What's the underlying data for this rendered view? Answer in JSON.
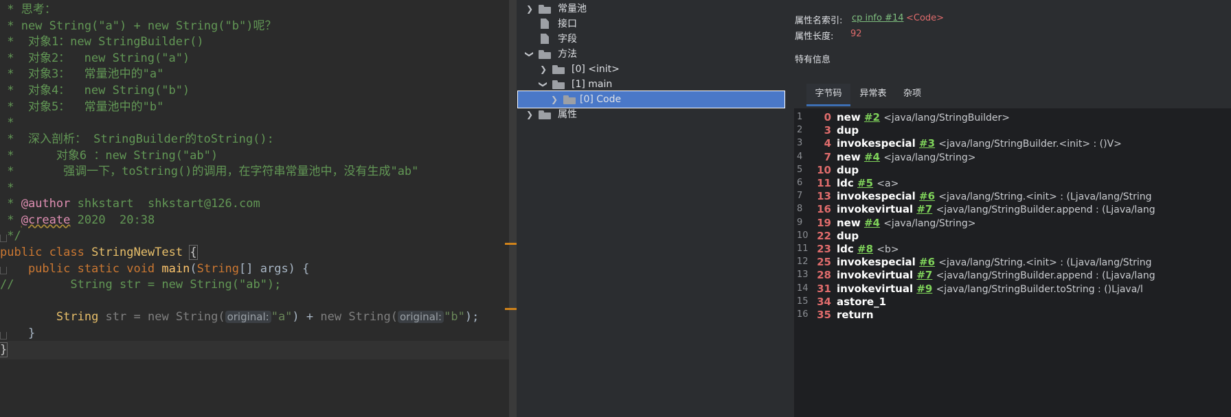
{
  "editor": {
    "lines": [
      " * 思考：",
      " * new String(\"a\") + new String(\"b\")呢？",
      " *  对象1：new StringBuilder()",
      " *  对象2：  new String(\"a\")",
      " *  对象3：  常量池中的\"a\"",
      " *  对象4：  new String(\"b\")",
      " *  对象5：  常量池中的\"b\"",
      " *",
      " *  深入剖析： StringBuilder的toString():",
      " *      对象6 ：new String(\"ab\")",
      " *       强调一下，toString()的调用，在字符串常量池中，没有生成\"ab\"",
      " *"
    ],
    "author_prefix": " * ",
    "author_tag": "@author",
    "author_text": " shkstart  shkstart@126.com",
    "create_prefix": " * ",
    "create_tag": "@create",
    "create_text": " 2020  20:38",
    "comment_end": " */",
    "class_kw": "public class ",
    "class_name": "StringNewTest",
    "class_brace": "{",
    "main_kw": "    public static void ",
    "main_name": "main",
    "main_params_open": "(",
    "main_param_type": "String",
    "main_params_rest": "[] args) {",
    "commented_line": "//        String str = new String(\"ab\");",
    "stmt_indent": "        ",
    "stmt_type": "String",
    "stmt_var": " str = ",
    "stmt_new1": "new ",
    "stmt_cls1": "String(",
    "hint1": "original:",
    "stmt_arg1": "\"a\"",
    "stmt_mid": ") + ",
    "stmt_new2": "new ",
    "stmt_cls2": "String(",
    "hint2": "original:",
    "stmt_arg2": "\"b\"",
    "stmt_end": ");",
    "close_method": "    }",
    "close_class": "}"
  },
  "tree": {
    "constant_pool": "常量池",
    "interfaces": "接口",
    "fields": "字段",
    "methods": "方法",
    "method_init": "[0] <init>",
    "method_main": "[1] main",
    "code_node": "[0] Code",
    "attributes": "属性"
  },
  "detail": {
    "attr_name_index_label": "属性名索引:",
    "attr_name_index_link": "cp info #14",
    "attr_name_index_value": "<Code>",
    "attr_length_label": "属性长度:",
    "attr_length_value": "92",
    "specific_info_label": "特有信息",
    "tabs": [
      "字节码",
      "异常表",
      "杂项"
    ],
    "active_tab": "字节码",
    "bytecode": [
      {
        "line": "1",
        "offset": "0",
        "op": "new",
        "ref": "#2",
        "arg": "<java/lang/StringBuilder>"
      },
      {
        "line": "2",
        "offset": "3",
        "op": "dup",
        "ref": "",
        "arg": ""
      },
      {
        "line": "3",
        "offset": "4",
        "op": "invokespecial",
        "ref": "#3",
        "arg": "<java/lang/StringBuilder.<init> : ()V>"
      },
      {
        "line": "4",
        "offset": "7",
        "op": "new",
        "ref": "#4",
        "arg": "<java/lang/String>"
      },
      {
        "line": "5",
        "offset": "10",
        "op": "dup",
        "ref": "",
        "arg": ""
      },
      {
        "line": "6",
        "offset": "11",
        "op": "ldc",
        "ref": "#5",
        "arg": "<a>"
      },
      {
        "line": "7",
        "offset": "13",
        "op": "invokespecial",
        "ref": "#6",
        "arg": "<java/lang/String.<init> : (Ljava/lang/String"
      },
      {
        "line": "8",
        "offset": "16",
        "op": "invokevirtual",
        "ref": "#7",
        "arg": "<java/lang/StringBuilder.append : (Ljava/lang"
      },
      {
        "line": "9",
        "offset": "19",
        "op": "new",
        "ref": "#4",
        "arg": "<java/lang/String>"
      },
      {
        "line": "10",
        "offset": "22",
        "op": "dup",
        "ref": "",
        "arg": ""
      },
      {
        "line": "11",
        "offset": "23",
        "op": "ldc",
        "ref": "#8",
        "arg": "<b>"
      },
      {
        "line": "12",
        "offset": "25",
        "op": "invokespecial",
        "ref": "#6",
        "arg": "<java/lang/String.<init> : (Ljava/lang/String"
      },
      {
        "line": "13",
        "offset": "28",
        "op": "invokevirtual",
        "ref": "#7",
        "arg": "<java/lang/StringBuilder.append : (Ljava/lang"
      },
      {
        "line": "14",
        "offset": "31",
        "op": "invokevirtual",
        "ref": "#9",
        "arg": "<java/lang/StringBuilder.toString : ()Ljava/l"
      },
      {
        "line": "15",
        "offset": "34",
        "op": "astore_1",
        "ref": "",
        "arg": ""
      },
      {
        "line": "16",
        "offset": "35",
        "op": "return",
        "ref": "",
        "arg": ""
      }
    ]
  }
}
